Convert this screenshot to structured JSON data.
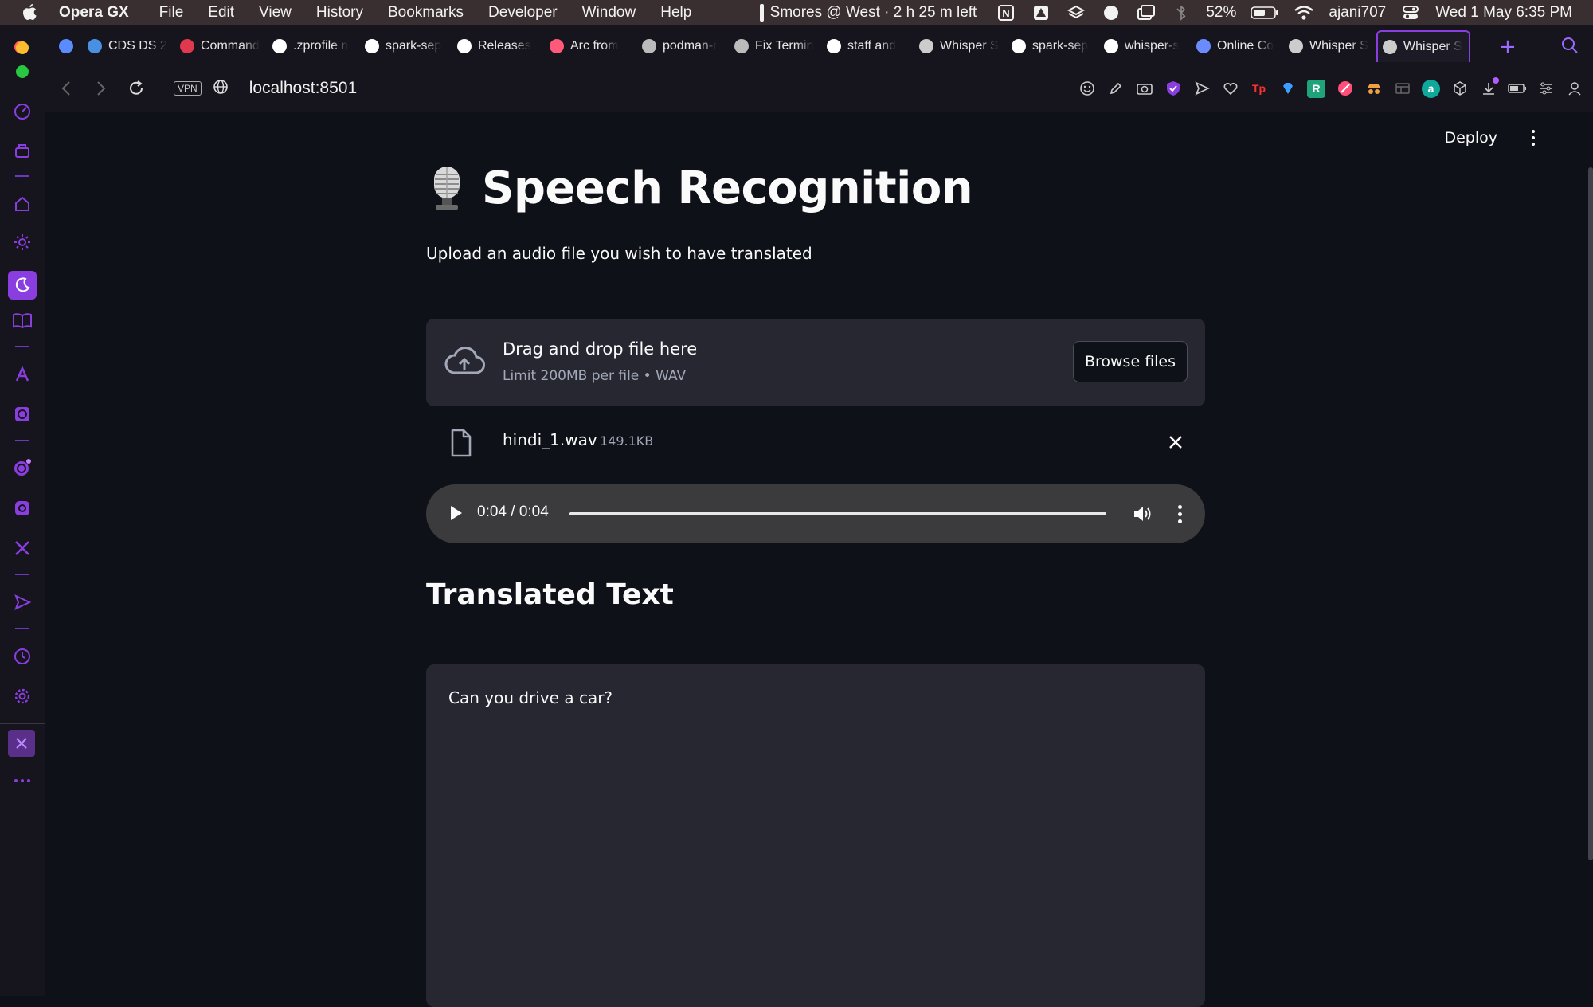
{
  "menubar": {
    "app_name": "Opera GX",
    "items": [
      "File",
      "Edit",
      "View",
      "History",
      "Bookmarks",
      "Developer",
      "Window",
      "Help"
    ],
    "now_playing": "Smores @ West · 2 h 25 m left",
    "battery": "52%",
    "user": "ajani707",
    "datetime": "Wed 1 May  6:35 PM"
  },
  "tabs": [
    {
      "label": "",
      "icon": "gem-icon",
      "color": "#5a8cff"
    },
    {
      "label": "CDS DS 2",
      "icon": "p-logo-icon",
      "color": "#4a90e2"
    },
    {
      "label": "Command",
      "icon": "crown-icon",
      "color": "#e0384d"
    },
    {
      "label": ".zprofile n",
      "icon": "google-icon",
      "color": "#ffffff"
    },
    {
      "label": "spark-sep",
      "icon": "github-icon",
      "color": "#ffffff"
    },
    {
      "label": "Releases",
      "icon": "github-icon",
      "color": "#ffffff"
    },
    {
      "label": "Arc from",
      "icon": "arc-icon",
      "color": "#ff5a7a"
    },
    {
      "label": "podman-r",
      "icon": "grid-icon",
      "color": "#bbbbbb"
    },
    {
      "label": "Fix Termin",
      "icon": "x-box-icon",
      "color": "#bbbbbb"
    },
    {
      "label": "staff and",
      "icon": "apple-icon",
      "color": "#ffffff"
    },
    {
      "label": "Whisper S",
      "icon": "microphone-icon",
      "color": "#cccccc"
    },
    {
      "label": "spark-sep",
      "icon": "github-icon",
      "color": "#ffffff"
    },
    {
      "label": "whisper-s",
      "icon": "github-icon",
      "color": "#ffffff"
    },
    {
      "label": "Online Co",
      "icon": "online-icon",
      "color": "#6b8cff"
    },
    {
      "label": "Whisper S",
      "icon": "microphone-icon",
      "color": "#cccccc"
    },
    {
      "label": "Whisper S",
      "icon": "microphone-icon",
      "color": "#cccccc",
      "active": true
    }
  ],
  "address": {
    "vpn_label": "VPN",
    "url": "localhost:8501"
  },
  "app": {
    "deploy_label": "Deploy",
    "title": "Speech Recognition",
    "subtitle": "Upload an audio file you wish to have translated",
    "uploader": {
      "drag_text": "Drag and drop file here",
      "limit_text": "Limit 200MB per file • WAV",
      "browse_label": "Browse files"
    },
    "file": {
      "name": "hindi_1.wav",
      "size": "149.1KB"
    },
    "audio": {
      "time": "0:04 / 0:04",
      "progress": 1.0
    },
    "section_heading": "Translated Text",
    "translated_text": "Can you drive a car?"
  },
  "colors": {
    "accent": "#8a3ee0",
    "background": "#0e1117",
    "widget_bg": "#262730"
  }
}
